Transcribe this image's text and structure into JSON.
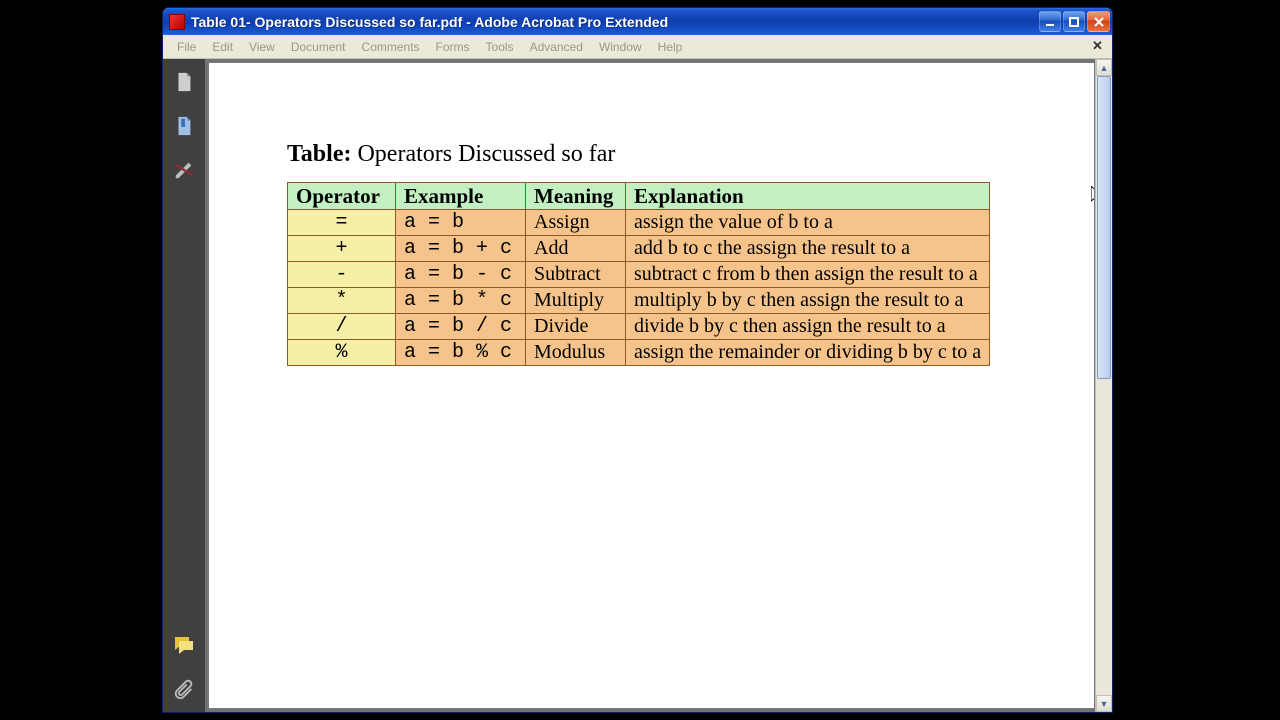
{
  "window": {
    "title": "Table 01- Operators Discussed so far.pdf - Adobe Acrobat Pro Extended"
  },
  "menu": {
    "items": [
      "File",
      "Edit",
      "View",
      "Document",
      "Comments",
      "Forms",
      "Tools",
      "Advanced",
      "Window",
      "Help"
    ]
  },
  "document": {
    "heading_label": "Table:",
    "heading_text": " Operators Discussed so far",
    "columns": [
      "Operator",
      "Example",
      "Meaning",
      "Explanation"
    ],
    "rows": [
      {
        "op": "=",
        "ex": "a = b",
        "mean": "Assign",
        "expl": "assign the value of b to a"
      },
      {
        "op": "+",
        "ex": "a = b + c",
        "mean": "Add",
        "expl": "add b to c the assign the result to a"
      },
      {
        "op": "-",
        "ex": "a = b - c",
        "mean": "Subtract",
        "expl": "subtract c from b then assign the result to a"
      },
      {
        "op": "*",
        "ex": "a = b * c",
        "mean": "Multiply",
        "expl": "multiply b by c then assign the result to a"
      },
      {
        "op": "/",
        "ex": "a = b / c",
        "mean": "Divide",
        "expl": "divide b by c then assign the result to a"
      },
      {
        "op": "%",
        "ex": "a = b % c",
        "mean": "Modulus",
        "expl": "assign the remainder or dividing b by c to a"
      }
    ]
  }
}
